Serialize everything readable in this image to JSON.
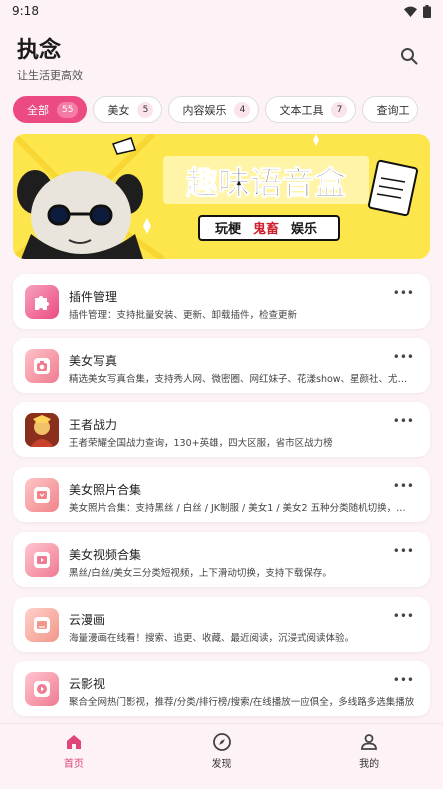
{
  "status_bar": {
    "time": "9:18"
  },
  "header": {
    "title": "执念",
    "subtitle": "让生活更高效"
  },
  "chips": [
    {
      "label": "全部",
      "count": "55",
      "active": true
    },
    {
      "label": "美女",
      "count": "5"
    },
    {
      "label": "内容娱乐",
      "count": "4"
    },
    {
      "label": "文本工具",
      "count": "7"
    },
    {
      "label": "查询工",
      "count": ""
    }
  ],
  "banner": {
    "headline": "趣味语音盒",
    "tags": [
      "玩梗",
      "鬼畜",
      "娱乐"
    ]
  },
  "plugins": [
    {
      "title": "插件管理",
      "desc": "插件管理：支持批量安装、更新、卸载插件，检查更新",
      "icon": "puzzle-icon"
    },
    {
      "title": "美女写真",
      "desc": "精选美女写真合集，支持秀人网、微密圈、网红妹子、花漾show、星颜社、尤果网等多个来源",
      "icon": "camera-icon"
    },
    {
      "title": "王者战力",
      "desc": "王者荣耀全国战力查询，130+英雄，四大区服，省市区战力榜",
      "icon": "game-hero-icon"
    },
    {
      "title": "美女照片合集",
      "desc": "美女照片合集：支持黑丝 / 白丝 / JK制服 / 美女1 / 美女2 五种分类随机切换，支持下载",
      "icon": "image-icon"
    },
    {
      "title": "美女视频合集",
      "desc": "黑丝/白丝/美女三分类短视频，上下滑动切换，支持下载保存。",
      "icon": "video-icon"
    },
    {
      "title": "云漫画",
      "desc": "海量漫画在线看！搜索、追更、收藏、最近阅读，沉浸式阅读体验。",
      "icon": "comic-icon"
    },
    {
      "title": "云影视",
      "desc": "聚合全网热门影视，推荐/分类/排行榜/搜索/在线播放一应俱全，多线路多选集播放",
      "icon": "play-icon"
    }
  ],
  "more_glyph": "•••",
  "bottom_nav": [
    {
      "label": "首页",
      "icon": "home-icon",
      "active": true
    },
    {
      "label": "发现",
      "icon": "compass-icon"
    },
    {
      "label": "我的",
      "icon": "user-icon"
    }
  ],
  "colors": {
    "accent": "#ec4a82",
    "background": "#fdf2f6",
    "banner_yellow": "#fde64b"
  }
}
